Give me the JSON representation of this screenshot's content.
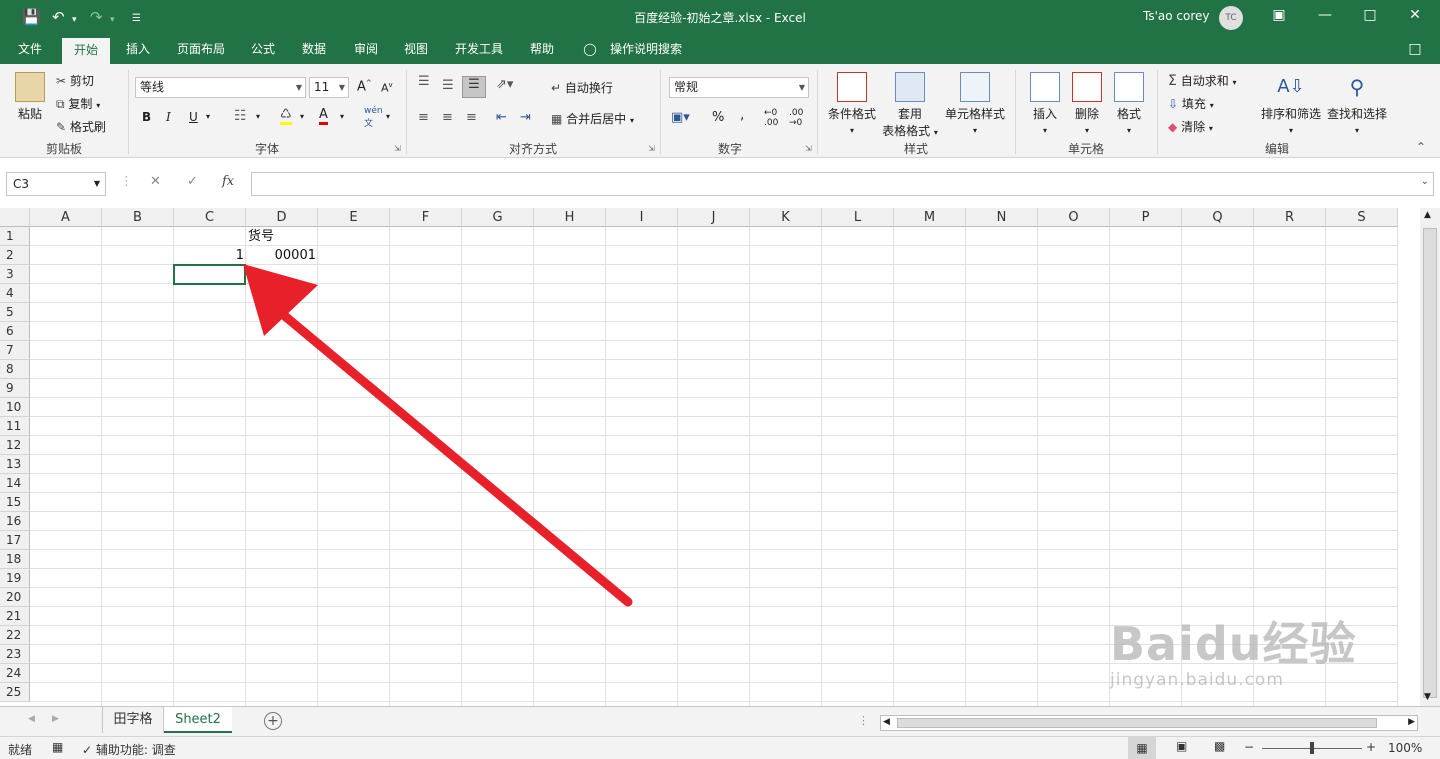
{
  "window": {
    "title": "百度经验-初始之章.xlsx  -  Excel",
    "user": "Ts'ao corey",
    "avatar": "TC"
  },
  "menu": [
    "文件",
    "开始",
    "插入",
    "页面布局",
    "公式",
    "数据",
    "审阅",
    "视图",
    "开发工具",
    "帮助",
    "操作说明搜索"
  ],
  "ribbon": {
    "clipboard": {
      "paste": "粘贴",
      "cut": "剪切",
      "copy": "复制",
      "format_painter": "格式刷",
      "label": "剪贴板"
    },
    "font": {
      "name": "等线",
      "size": "11",
      "label": "字体",
      "bold": "B",
      "italic": "I",
      "underline": "U"
    },
    "alignment": {
      "wrap": "自动换行",
      "merge": "合并后居中",
      "label": "对齐方式"
    },
    "number": {
      "format": "常规",
      "label": "数字",
      "percent": "%"
    },
    "styles": {
      "conditional": "条件格式",
      "table_l1": "套用",
      "table_l2": "表格格式",
      "cell_styles": "单元格样式",
      "label": "样式"
    },
    "cells": {
      "insert": "插入",
      "delete": "删除",
      "format": "格式",
      "label": "单元格"
    },
    "editing": {
      "autosum": "自动求和",
      "fill": "填充",
      "clear": "清除",
      "sort": "排序和筛选",
      "find": "查找和选择",
      "label": "编辑"
    }
  },
  "formula_bar": {
    "name_box": "C3",
    "fx": "fx",
    "value": ""
  },
  "sheet": {
    "columns": [
      "A",
      "B",
      "C",
      "D",
      "E",
      "F",
      "G",
      "H",
      "I",
      "J",
      "K",
      "L",
      "M",
      "N",
      "O",
      "P",
      "Q",
      "R",
      "S"
    ],
    "rows": [
      "1",
      "2",
      "3",
      "4",
      "5",
      "6",
      "7",
      "8",
      "9",
      "10",
      "11",
      "12",
      "13",
      "14",
      "15",
      "16",
      "17",
      "18",
      "19",
      "20",
      "21",
      "22",
      "23",
      "24",
      "25"
    ],
    "cells": {
      "D1": "货号",
      "C2": "1",
      "D2": "00001"
    }
  },
  "tabs": [
    "田字格",
    "Sheet2"
  ],
  "status": {
    "ready": "就绪",
    "accessibility": "辅助功能: 调查",
    "zoom": "100%"
  },
  "watermark": {
    "brand": "Baidu经验",
    "url": "jingyan.baidu.com"
  }
}
